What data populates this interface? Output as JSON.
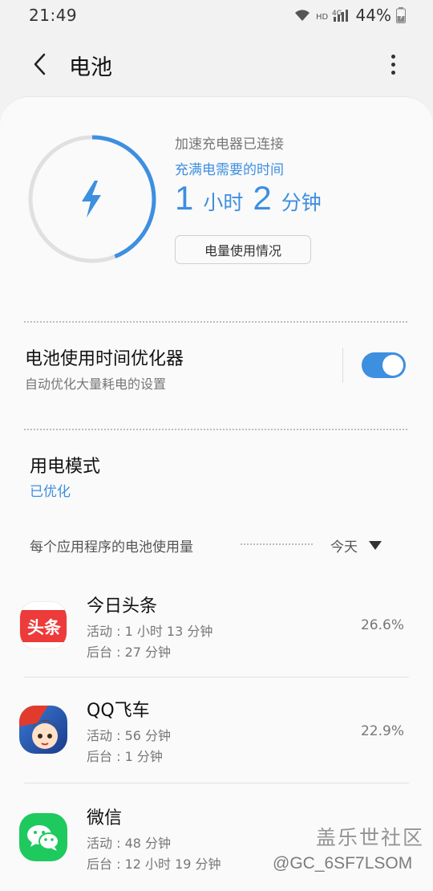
{
  "status_bar": {
    "time": "21:49",
    "network": "HD 4G",
    "battery_percent": "44%"
  },
  "header": {
    "title": "电池",
    "back_icon": "chevron-left-icon",
    "more_icon": "more-vertical-icon"
  },
  "battery": {
    "charge_status": "加速充电器已连接",
    "full_time_label": "充满电需要的时间",
    "hours": "1",
    "hours_unit": "小时",
    "minutes": "2",
    "minutes_unit": "分钟",
    "level_percent": 44,
    "usage_button": "电量使用情况",
    "accent_color": "#3d8fe0"
  },
  "optimizer": {
    "title": "电池使用时间优化器",
    "subtitle": "自动优化大量耗电的设置",
    "enabled": true
  },
  "power_mode": {
    "title": "用电模式",
    "value": "已优化"
  },
  "app_usage": {
    "header": "每个应用程序的电池使用量",
    "period": "今天",
    "apps": [
      {
        "name": "今日头条",
        "active": "活动 : 1 小时 13 分钟",
        "background": "后台 : 27 分钟",
        "percent": "26.6%",
        "icon_text": "头条"
      },
      {
        "name": "QQ飞车",
        "active": "活动 : 56 分钟",
        "background": "后台 : 1 分钟",
        "percent": "22.9%",
        "icon_text": ""
      },
      {
        "name": "微信",
        "active": "活动 : 48 分钟",
        "background": "后台 : 12 小时 19 分钟",
        "percent": "",
        "icon_text": ""
      }
    ]
  },
  "watermark": {
    "site": "盖乐世社区",
    "user": "@GC_6SF7LSOM"
  }
}
